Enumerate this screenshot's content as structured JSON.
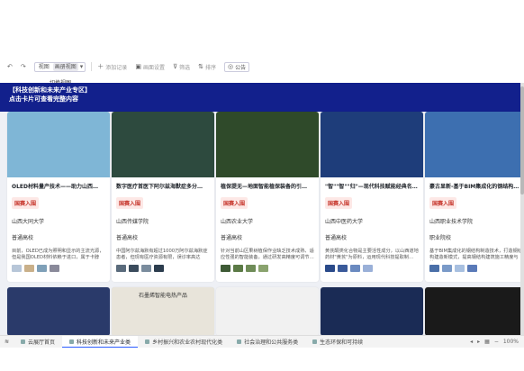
{
  "toolbar": {
    "undo_icon": "undo-icon",
    "redo_icon": "redo-icon",
    "view_label": "视图",
    "view_active": "画册视图",
    "add_record": "添加记录",
    "add_record_disabled_label": "画面设置",
    "filter": "筛选",
    "sort": "排序",
    "share": "公告"
  },
  "tooltip": "切换视图",
  "banner": {
    "line1": "【科技创新和未来产业专区】",
    "line2": "点击卡片可查看完整内容"
  },
  "cards": [
    {
      "title": "OLED材料量产技术——助力山西…",
      "badge": "国赛入围",
      "school": "山西大同大学",
      "type": "普通高校",
      "desc": "目前，OLED已成为照明和显示的主流光源，但是我国OLED材料依赖于进口，属于卡脖子…",
      "img_bg": "#7fb6d6",
      "thumbs": [
        "#b7c6d8",
        "#c9b08a",
        "#7fa0b8",
        "#8a8a9a"
      ]
    },
    {
      "title": "数字医疗首医下阿尔兹海默症多分…",
      "badge": "国赛入围",
      "school": "山西传媒学院",
      "type": "普通高校",
      "desc": "中国阿尔兹海默有超过1000万阿尔兹海默症患者，但现有医疗资源有限，误诊率高达20%，基…",
      "img_bg": "#2d4a3e",
      "thumbs": [
        "#5a6b7c",
        "#3b4c5d",
        "#7a8c9d",
        "#2c3d4e"
      ]
    },
    {
      "title": "植保提无—地面智能植保装备的引…",
      "badge": "国赛入围",
      "school": "山西农业大学",
      "type": "普通高校",
      "desc": "针对当前山区果树植保作业缺乏技术成熟、适应性强的智能装备，通过研发高精度可调节…",
      "img_bg": "#2f4a2a",
      "thumbs": [
        "#3e5a35",
        "#5b7a46",
        "#6f8c58",
        "#8aa36e"
      ]
    },
    {
      "title": "\"智\"\"智\"\"归\"—现代科技赋能经典名…",
      "badge": "国赛入围",
      "school": "山西中医药大学",
      "type": "普通高校",
      "desc": "黄芪酮类化合物是主要活性成分，以山西道地药材\"黄芪\"为原料，运用现代科技提取制…",
      "img_bg": "#1e3d7a",
      "thumbs": [
        "#2a4a8a",
        "#3a5a9a",
        "#6a8ac0",
        "#9ab0d8"
      ]
    },
    {
      "title": "豪古显新-基于BIM集成化的钢结构…",
      "badge": "国赛入围",
      "school": "山西职业技术学院",
      "type": "职业院校",
      "desc": "基于BIM集成化的钢结构制造技术，打造钢结构建造新模式，提高钢结构建筑施工精度与效…",
      "img_bg": "#3d6fb0",
      "thumbs": [
        "#4a6fa8",
        "#7a9ac8",
        "#a8c0e0",
        "#5a7ab8"
      ]
    }
  ],
  "row2_cards": [
    {
      "img_bg": "#2a3a6a",
      "caption": ""
    },
    {
      "img_bg": "#e8e4da",
      "caption": "石墨烯智能电热产品"
    },
    {
      "img_bg": "#f1f1f1",
      "caption": ""
    },
    {
      "img_bg": "#1a2b55",
      "caption": ""
    },
    {
      "img_bg": "#1a1a1a",
      "caption": ""
    }
  ],
  "tabs": [
    {
      "label": "云展厅首页",
      "active": false
    },
    {
      "label": "科技创新和未来产业类",
      "active": true
    },
    {
      "label": "乡村振兴和农业农村现代化类",
      "active": false
    },
    {
      "label": "社会治理和公共服务类",
      "active": false
    },
    {
      "label": "生态环保和可持续",
      "active": false
    }
  ],
  "zoom_label": "100%"
}
